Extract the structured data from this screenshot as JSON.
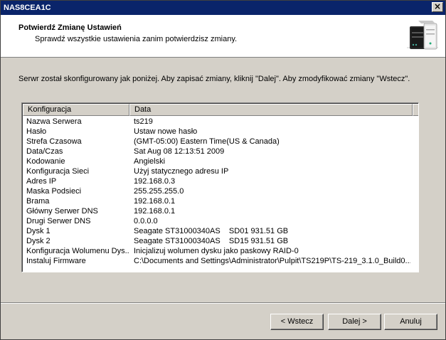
{
  "window": {
    "title": "NAS8CEA1C",
    "close_glyph": "×"
  },
  "header": {
    "title": "Potwierdź Zmianę Ustawień",
    "subtitle": "Sprawdź wszystkie ustawienia zanim potwierdzisz zmiany."
  },
  "intro": "Serwr został skonfigurowany jak poniżej. Aby zapisać zmiany, kliknij \"Dalej\". Aby zmodyfikować zmiany \"Wstecz\".",
  "table": {
    "columns": [
      "Konfiguracja",
      "Data"
    ],
    "rows": [
      {
        "k": "Nazwa Serwera",
        "v": "ts219"
      },
      {
        "k": "Hasło",
        "v": "Ustaw nowe hasło"
      },
      {
        "k": "Strefa Czasowa",
        "v": "(GMT-05:00) Eastern Time(US & Canada)"
      },
      {
        "k": "Data/Czas",
        "v": "Sat Aug 08 12:13:51 2009"
      },
      {
        "k": "Kodowanie",
        "v": "Angielski"
      },
      {
        "k": "Konfiguracja Sieci",
        "v": "Użyj statycznego adresu IP"
      },
      {
        "k": "Adres IP",
        "v": "192.168.0.3"
      },
      {
        "k": "Maska Podsieci",
        "v": "255.255.255.0"
      },
      {
        "k": "Brama",
        "v": "192.168.0.1"
      },
      {
        "k": "Główny Serwer DNS",
        "v": "192.168.0.1"
      },
      {
        "k": "Drugi Serwer DNS",
        "v": "0.0.0.0"
      },
      {
        "k": "Dysk 1",
        "v": "Seagate ST31000340AS    SD01 931.51 GB"
      },
      {
        "k": "Dysk 2",
        "v": "Seagate ST31000340AS    SD15 931.51 GB"
      },
      {
        "k": "Konfiguracja Wolumenu Dys...",
        "v": "Inicjalizuj wolumen dysku jako paskowy RAID-0"
      },
      {
        "k": "Instaluj Firmware",
        "v": "C:\\Documents and Settings\\Administrator\\Pulpit\\TS219P\\TS-219_3.1.0_Build0..."
      }
    ]
  },
  "buttons": {
    "back": "< Wstecz",
    "next": "Dalej >",
    "cancel": "Anuluj"
  }
}
